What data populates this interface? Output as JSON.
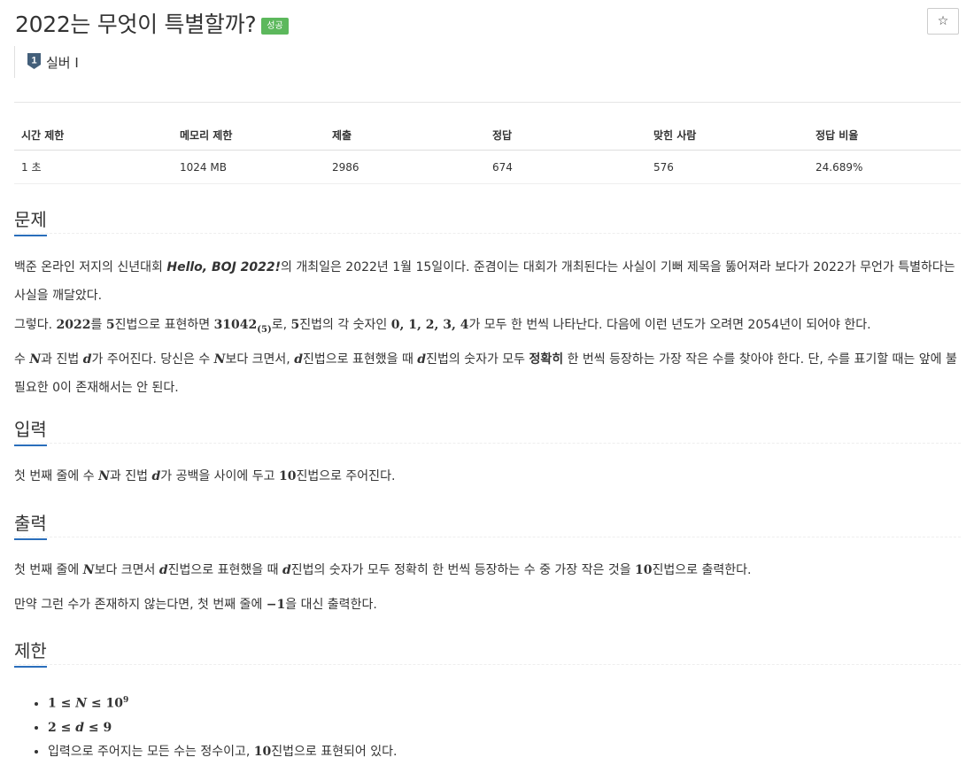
{
  "problem": {
    "title": "2022는 무엇이 특별할까?",
    "status_badge": "성공",
    "star_icon": "☆",
    "tier": {
      "icon_text": "1",
      "label": "실버 I",
      "icon": "silver-tier-icon",
      "color": "#435f7a"
    }
  },
  "info_table": {
    "headers": [
      "시간 제한",
      "메모리 제한",
      "제출",
      "정답",
      "맞힌 사람",
      "정답 비율"
    ],
    "values": [
      "1 초",
      "1024 MB",
      "2986",
      "674",
      "576",
      "24.689%"
    ]
  },
  "sections": {
    "problem_h": "문제",
    "input_h": "입력",
    "output_h": "출력",
    "limit_h": "제한"
  },
  "desc": {
    "p1_a": "백준 온라인 저지의 신년대회 ",
    "p1_b": "Hello, BOJ 2022!",
    "p1_c": "의 개최일은 2022년 1월 15일이다. 준겸이는 대회가 개최된다는 사실이 기뻐 제목을 뚫어져라 보다가 2022가 무언가 특별하다는 사실을 깨달았다.",
    "p2_a": "그렇다. ",
    "p2_m1": "2022",
    "p2_b": "를 ",
    "p2_m2": "5",
    "p2_c": "진법으로 표현하면 ",
    "p2_m3": "31042",
    "p2_m3sub": "(5)",
    "p2_d": "로, ",
    "p2_m4": "5",
    "p2_e": "진법의 각 숫자인 ",
    "p2_m5": "0, 1, 2, 3, 4",
    "p2_f": "가 모두 한 번씩 나타난다. 다음에 이런 년도가 오려면 2054년이 되어야 한다.",
    "p3_a": "수 ",
    "p3_N": "N",
    "p3_b": "과 진법 ",
    "p3_d": "d",
    "p3_c": "가 주어진다. 당신은 수 ",
    "p3_N2": "N",
    "p3_e": "보다 크면서, ",
    "p3_d2": "d",
    "p3_f": "진법으로 표현했을 때 ",
    "p3_d3": "d",
    "p3_g": "진법의 숫자가 모두 ",
    "p3_bold": "정확히",
    "p3_h": " 한 번씩 등장하는 가장 작은 수를 찾아야 한다. 단, 수를 표기할 때는 앞에 불필요한 0이 존재해서는 안 된다."
  },
  "input": {
    "a": "첫 번째 줄에 수 ",
    "N": "N",
    "b": "과 진법 ",
    "d": "d",
    "c": "가 공백을 사이에 두고 ",
    "m": "10",
    "e": "진법으로 주어진다."
  },
  "output": {
    "l1_a": "첫 번째 줄에 ",
    "l1_N": "N",
    "l1_b": "보다 크면서 ",
    "l1_d": "d",
    "l1_c": "진법으로 표현했을 때 ",
    "l1_d2": "d",
    "l1_e": "진법의 숫자가 모두 정확히 한 번씩 등장하는 수 중 가장 작은 것을 ",
    "l1_m": "10",
    "l1_f": "진법으로 출력한다.",
    "l2_a": "만약 그런 수가 존재하지 않는다면, 첫 번째 줄에 ",
    "l2_m": "−1",
    "l2_b": "을 대신 출력한다."
  },
  "limits": {
    "l1_a": "1 ≤ ",
    "l1_N": "N",
    "l1_b": " ≤ 10",
    "l1_sup": "9",
    "l2_a": "2 ≤ ",
    "l2_d": "d",
    "l2_b": " ≤ 9",
    "l3_a": "입력으로 주어지는 모든 수는 정수이고, ",
    "l3_m": "10",
    "l3_b": "진법으로 표현되어 있다."
  }
}
